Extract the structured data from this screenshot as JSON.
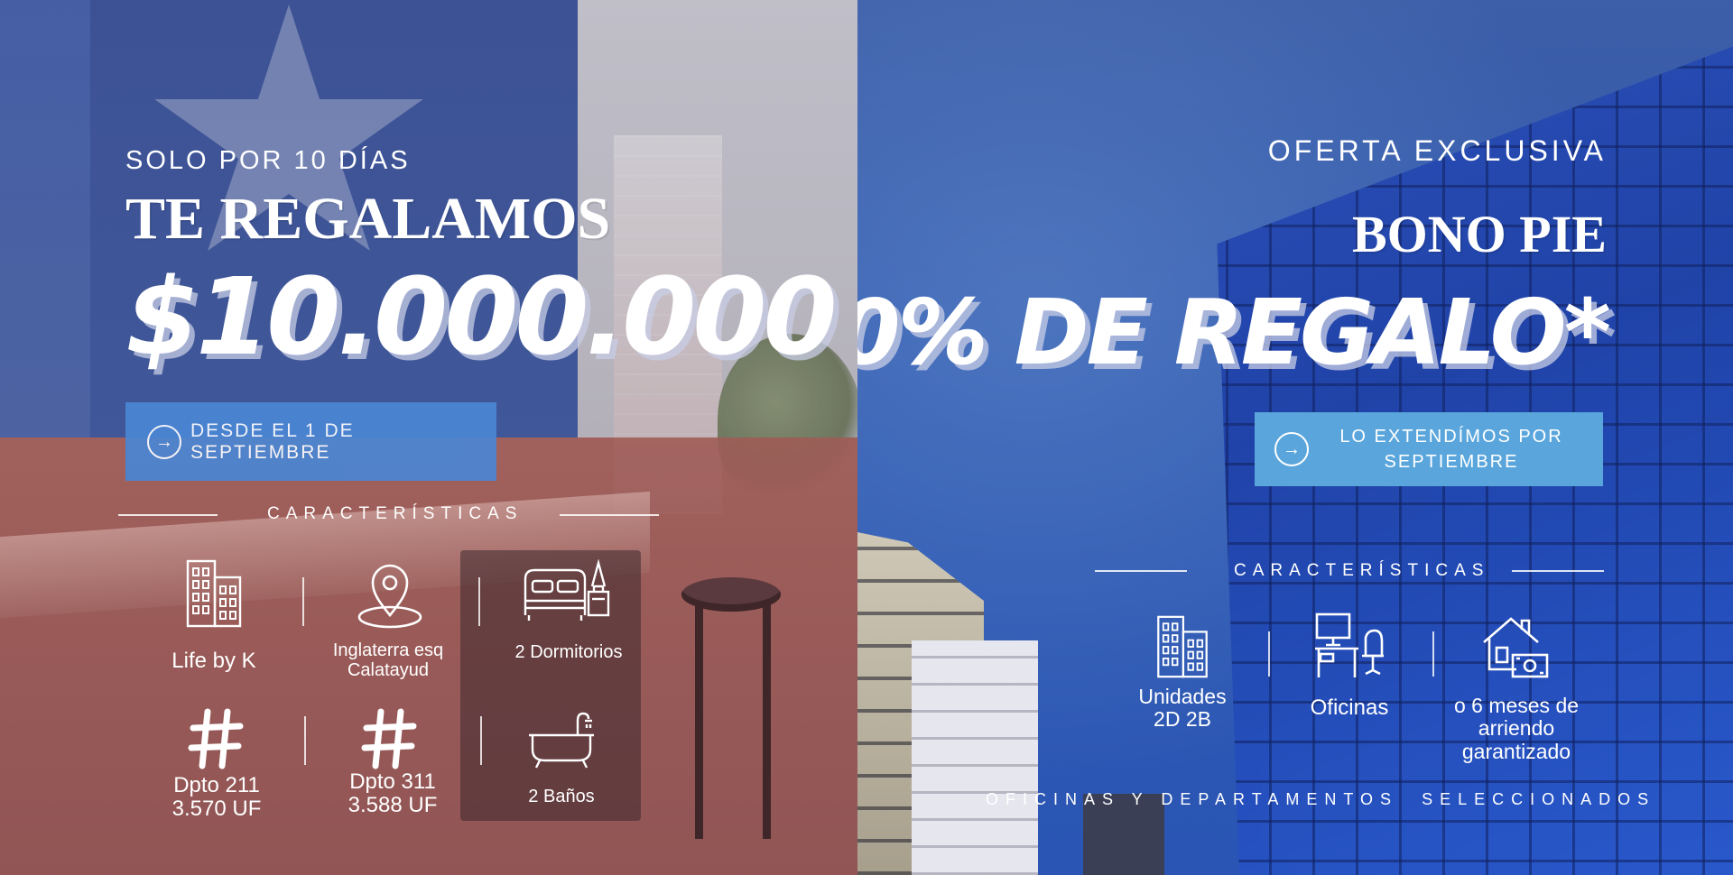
{
  "left": {
    "eyebrow": "SOLO POR 10 DÍAS",
    "headline": "TE REGALAMOS",
    "amount": "$10.000.000",
    "cta_label": "DESDE EL 1 DE SEPTIEMBRE",
    "section_title": "CARACTERÍSTICAS",
    "features": {
      "building": "Life by K",
      "location_line1": "Inglaterra esq",
      "location_line2": "Calatayud",
      "bedrooms": "2 Dormitorios",
      "unit1_name": "Dpto 211",
      "unit1_price": "3.570 UF",
      "unit2_name": "Dpto 311",
      "unit2_price": "3.588 UF",
      "bathrooms": "2 Baños"
    },
    "colors": {
      "cta_bg": "#4a86d4",
      "top_tint": "#3a5aa6",
      "bottom_tint": "#a86a66"
    }
  },
  "right": {
    "eyebrow": "OFERTA EXCLUSIVA",
    "headline": "BONO PIE",
    "offer": "10% DE REGALO*",
    "cta_line1": "LO EXTENDÍMOS POR",
    "cta_line2": "SEPTIEMBRE",
    "section_title": "CARACTERÍSTICAS",
    "features": {
      "units_line1": "Unidades",
      "units_line2": "2D 2B",
      "offices": "Oficinas",
      "lease_line1": "o 6 meses de",
      "lease_line2": "arriendo",
      "lease_line3": "garantizado"
    },
    "footer": "OFICINAS Y DEPARTAMENTOS  SELECCIONADOS",
    "colors": {
      "cta_bg": "#5aa6dc",
      "sky": "#2f59b0"
    }
  },
  "icons": {
    "building": "office-building-icon",
    "location": "map-pin-icon",
    "bed": "bed-icon",
    "hash": "hashtag-icon",
    "bath": "bathtub-icon",
    "desk": "office-desk-icon",
    "house": "house-money-icon",
    "arrow": "arrow-right-circle-icon"
  }
}
